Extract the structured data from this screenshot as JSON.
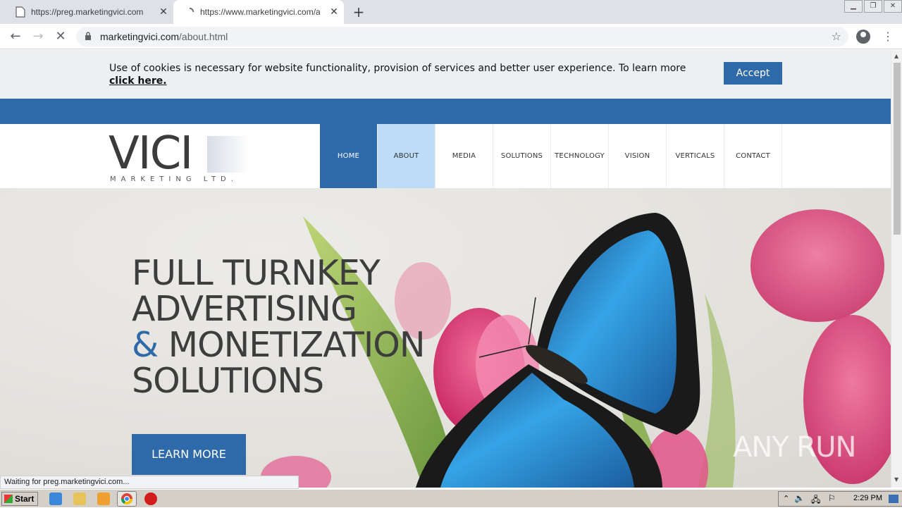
{
  "browser": {
    "tabs": [
      {
        "title": "https://preg.marketingvici.com",
        "active": false
      },
      {
        "title": "https://www.marketingvici.com/about.html",
        "active": true
      }
    ],
    "url_domain": "marketingvici.com",
    "url_path": "/about.html",
    "status_text": "Waiting for preg.marketingvici.com..."
  },
  "cookie_banner": {
    "text": "Use of cookies is necessary for website functionality, provision of services and better user experience. To learn more",
    "link": "click here.",
    "accept_label": "Accept"
  },
  "logo": {
    "main": "VICI",
    "sub": "MARKETING LTD."
  },
  "nav": {
    "items": [
      "HOME",
      "ABOUT",
      "MEDIA",
      "SOLUTIONS",
      "TECHNOLOGY",
      "VISION",
      "VERTICALS",
      "CONTACT"
    ]
  },
  "hero": {
    "line1": "FULL TURNKEY",
    "line2": "ADVERTISING",
    "amp": "&",
    "line3": "MONETIZATION",
    "line4": "SOLUTIONS",
    "cta": "LEARN MORE",
    "watermark": "ANY RUN"
  },
  "taskbar": {
    "start_label": "Start",
    "clock": "2:29 PM"
  },
  "colors": {
    "brand_blue": "#2e6aa9",
    "active_nav_light": "#bcdcf7"
  }
}
